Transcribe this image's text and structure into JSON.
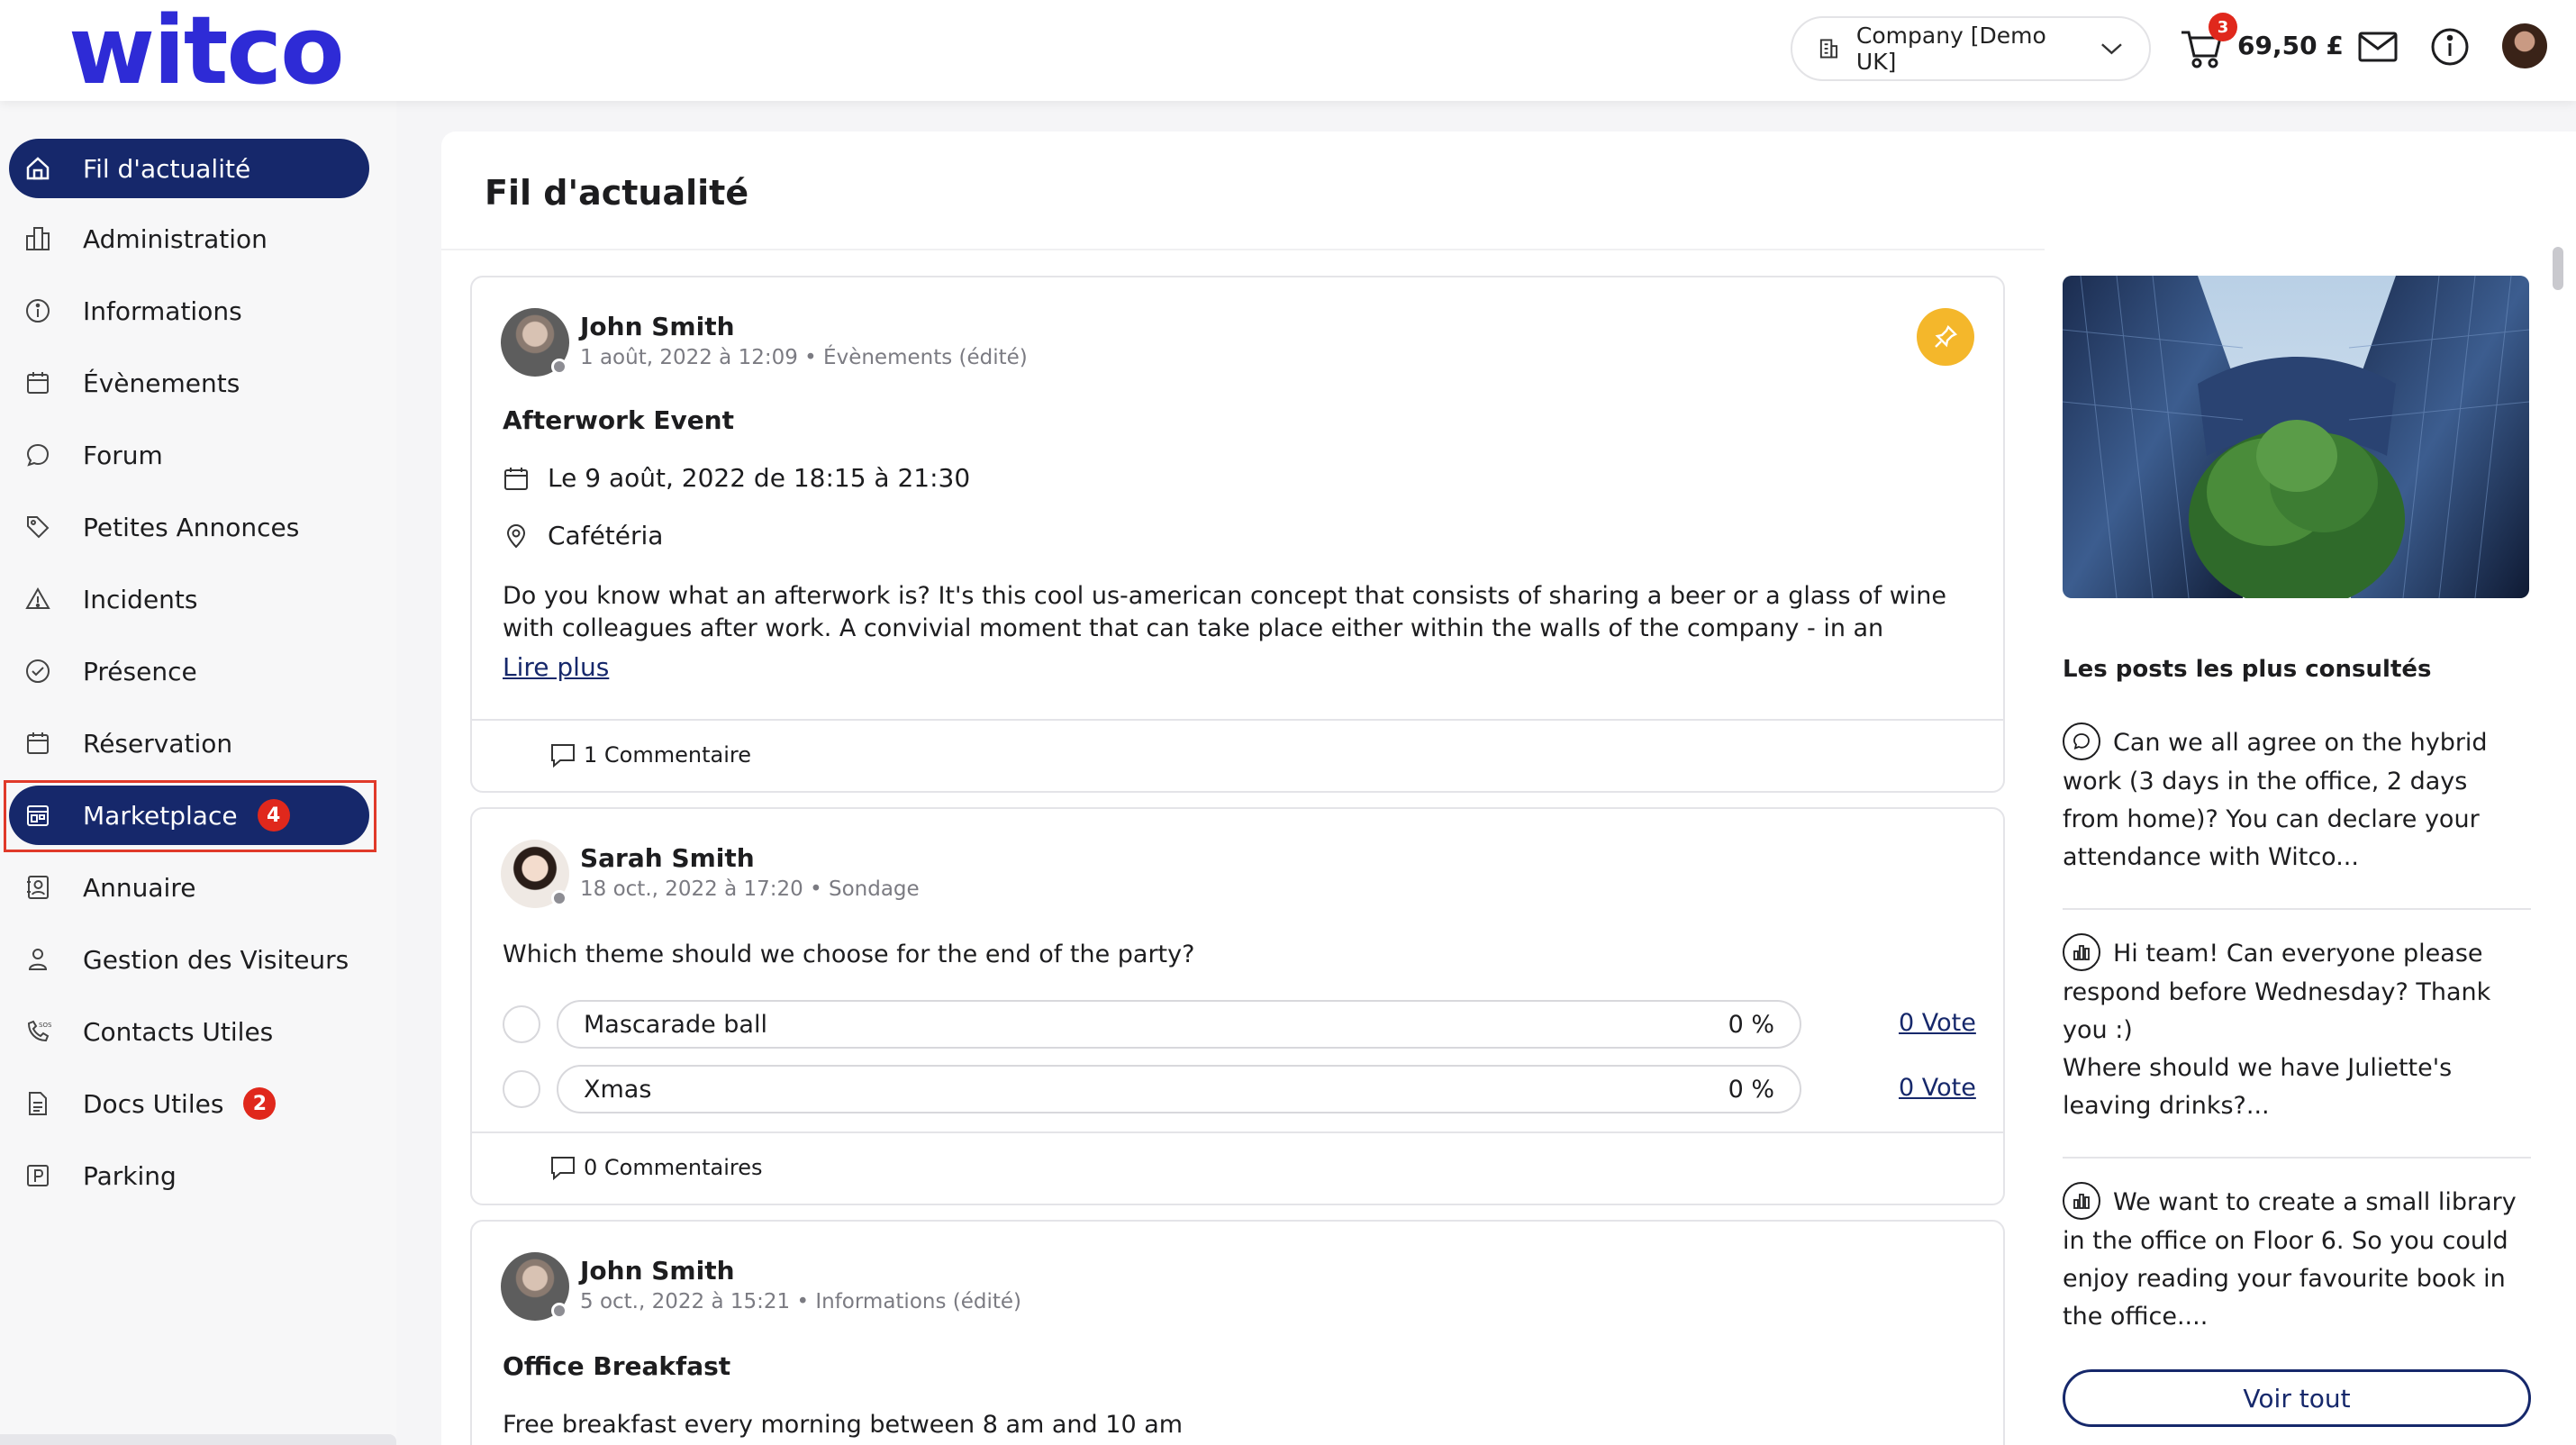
{
  "header": {
    "logo": "witco",
    "company_selector": "Company [Demo UK]",
    "cart_count": "3",
    "cart_amount": "69,50 £"
  },
  "sidebar": {
    "items": [
      {
        "label": "Fil d'actualité",
        "icon": "home-icon",
        "active": true
      },
      {
        "label": "Administration",
        "icon": "buildings-icon"
      },
      {
        "label": "Informations",
        "icon": "info-icon"
      },
      {
        "label": "Évènements",
        "icon": "calendar-icon"
      },
      {
        "label": "Forum",
        "icon": "chat-icon"
      },
      {
        "label": "Petites Annonces",
        "icon": "tag-icon"
      },
      {
        "label": "Incidents",
        "icon": "warning-icon"
      },
      {
        "label": "Présence",
        "icon": "check-circle-icon"
      },
      {
        "label": "Réservation",
        "icon": "calendar-icon"
      },
      {
        "label": "Marketplace",
        "icon": "store-icon",
        "badge": "4",
        "highlighted": true
      },
      {
        "label": "Annuaire",
        "icon": "contact-book-icon"
      },
      {
        "label": "Gestion des Visiteurs",
        "icon": "visitor-icon"
      },
      {
        "label": "Contacts Utiles",
        "icon": "phone-sos-icon"
      },
      {
        "label": "Docs Utiles",
        "icon": "document-icon",
        "badge": "2"
      },
      {
        "label": "Parking",
        "icon": "parking-icon"
      }
    ]
  },
  "main": {
    "title": "Fil d'actualité",
    "posts": [
      {
        "author": "John Smith",
        "meta": "1 août, 2022 à 12:09 • Évènements (édité)",
        "title": "Afterwork Event",
        "date_line": "Le 9 août, 2022 de 18:15 à 21:30",
        "location": "Cafétéria",
        "body": "Do you know what an afterwork is? It's this cool us-american concept that consists of sharing a beer or a glass of wine with colleagues after work. A convivial moment that can take place either within the walls of the company - in an authorised",
        "read_more": "Lire plus",
        "comments": "1 Commentaire"
      },
      {
        "author": "Sarah Smith",
        "meta": "18 oct., 2022 à 17:20 • Sondage",
        "question": "Which theme should we choose for the end of the party?",
        "options": [
          {
            "label": "Mascarade ball",
            "percent": "0 %",
            "votes": "0 Vote"
          },
          {
            "label": "Xmas",
            "percent": "0 %",
            "votes": "0 Vote"
          }
        ],
        "comments": "0 Commentaires"
      },
      {
        "author": "John Smith",
        "meta": "5 oct., 2022 à 15:21 • Informations (édité)",
        "title": "Office Breakfast",
        "body": "Free breakfast every morning between 8 am and 10 am"
      }
    ]
  },
  "right": {
    "most_viewed_title": "Les posts les plus consultés",
    "posts": [
      {
        "icon": "chat-icon",
        "text": "Can we all agree on the hybrid work (3 days in the office, 2 days from home)? You can declare your attendance with Witco..."
      },
      {
        "icon": "poll-icon",
        "text": "Hi team! Can everyone please respond before Wednesday? Thank you :)",
        "text2": "Where should we have Juliette's leaving drinks?..."
      },
      {
        "icon": "poll-icon",
        "text": "We want to create a small library in the office on Floor 6. So you could enjoy reading your favourite book in the office...."
      }
    ],
    "see_all": "Voir tout"
  },
  "colors": {
    "brand": "#2e2bd6",
    "nav_active": "#16286b",
    "badge": "#e0281c",
    "pin": "#f4b72b",
    "highlight": "#e03a2a"
  }
}
